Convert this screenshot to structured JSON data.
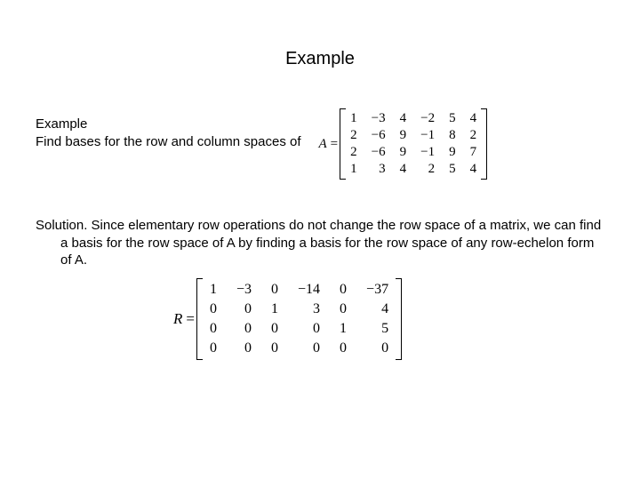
{
  "title": "Example",
  "section_label": "Example",
  "prompt": "Find bases for the row and column spaces of",
  "matrixA": {
    "lhs": "A",
    "rows": [
      [
        "1",
        "−3",
        "4",
        "−2",
        "5",
        "4"
      ],
      [
        "2",
        "−6",
        "9",
        "−1",
        "8",
        "2"
      ],
      [
        "2",
        "−6",
        "9",
        "−1",
        "9",
        "7"
      ],
      [
        "1",
        "3",
        "4",
        "2",
        "5",
        "4"
      ]
    ]
  },
  "solution_text": "Solution. Since elementary row operations do not change the row space of a matrix, we can find a basis for the row space of A by finding a basis for the row space of any row-echelon form of A.",
  "matrixR": {
    "lhs": "R",
    "rows": [
      [
        "1",
        "−3",
        "0",
        "−14",
        "0",
        "−37"
      ],
      [
        "0",
        "0",
        "1",
        "3",
        "0",
        "4"
      ],
      [
        "0",
        "0",
        "0",
        "0",
        "1",
        "5"
      ],
      [
        "0",
        "0",
        "0",
        "0",
        "0",
        "0"
      ]
    ]
  }
}
